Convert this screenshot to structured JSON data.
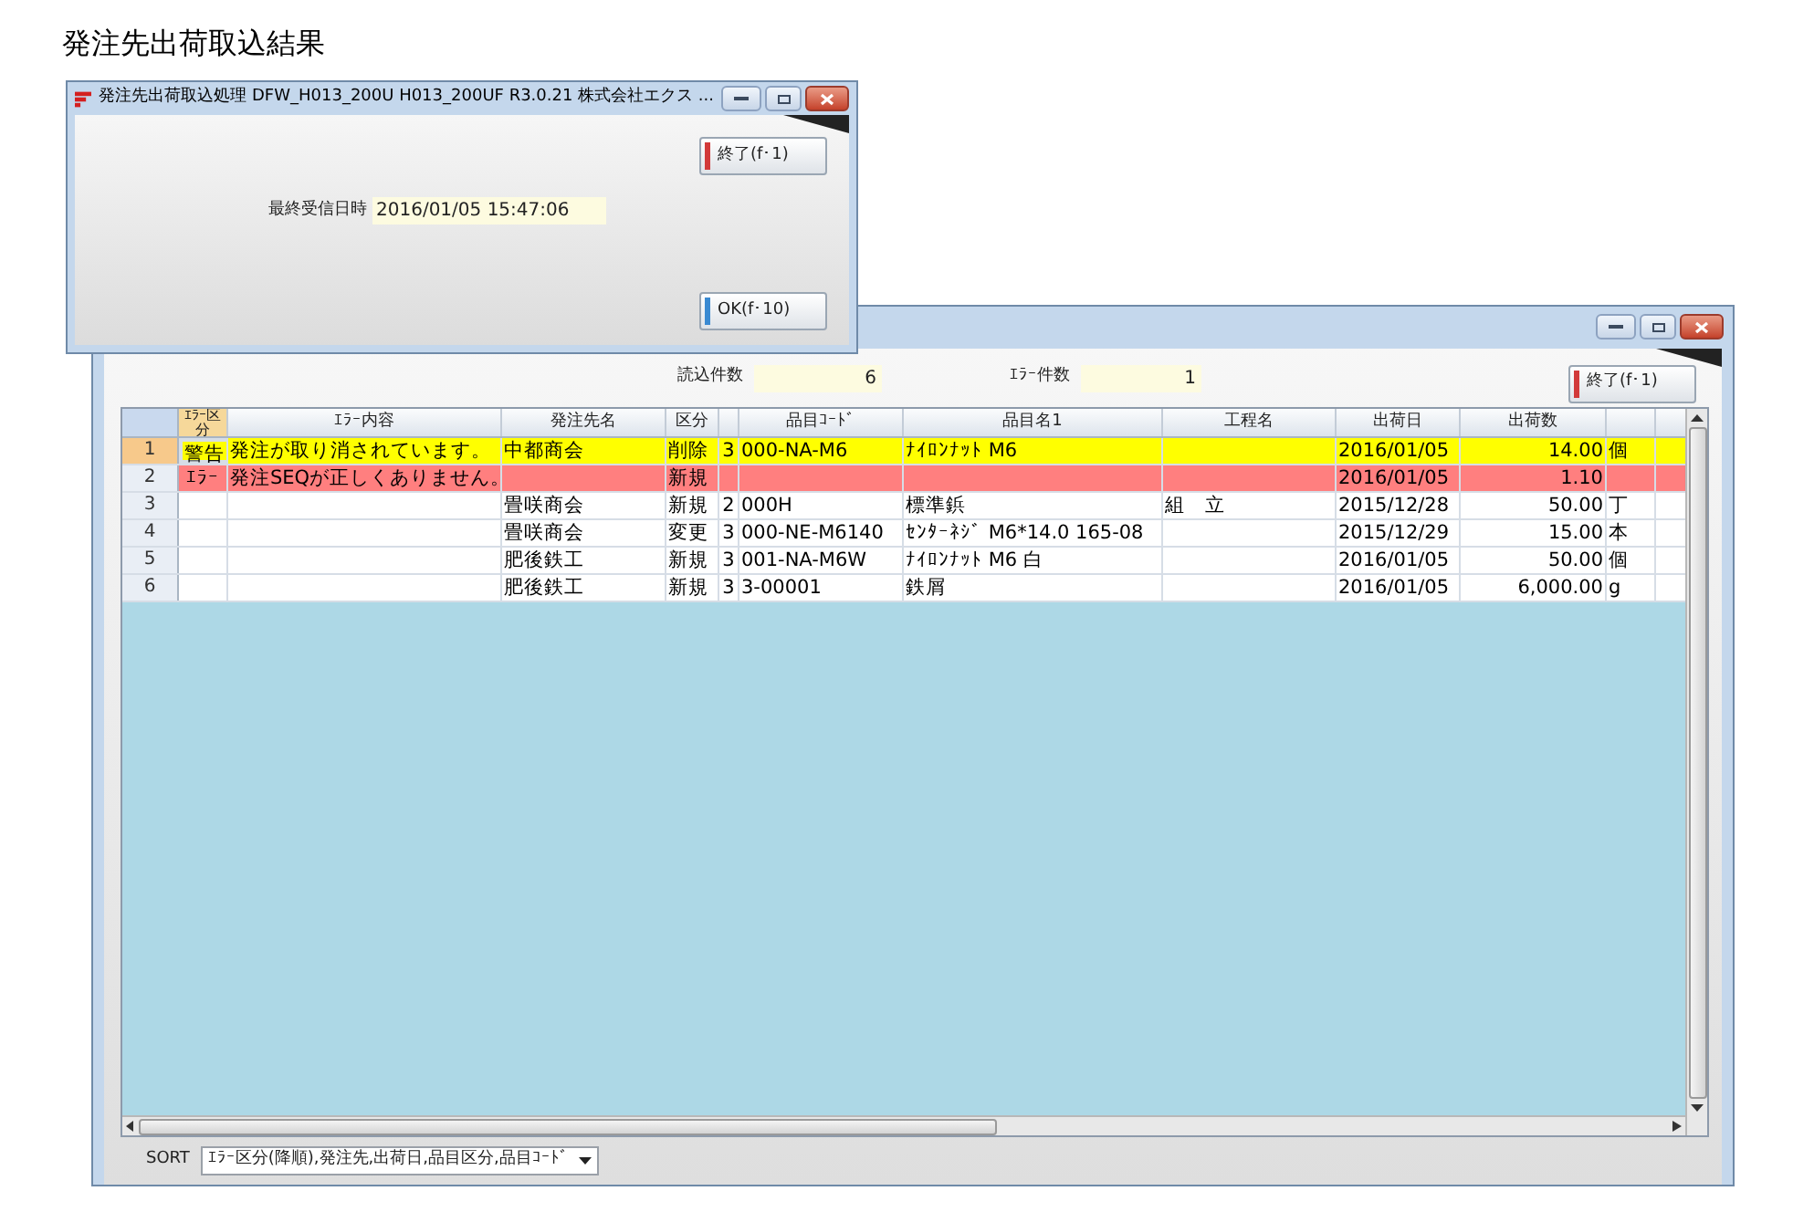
{
  "page_title": "発注先出荷取込結果",
  "dialog": {
    "title": "発注先出荷取込処理 DFW_H013_200U H013_200UF R3.0.21 株式会社エクス ...",
    "close_button": "終了(f･1)",
    "last_received_label": "最終受信日時",
    "last_received_value": "2016/01/05 15:47:06",
    "ok_button": "OK(f･10)"
  },
  "main_window": {
    "read_count_label": "読込件数",
    "read_count": "6",
    "error_count_label": "ｴﾗｰ件数",
    "error_count": "1",
    "close_button": "終了(f･1)",
    "table": {
      "columns": [
        {
          "kind": "text",
          "label": "ｴﾗｰ区分"
        },
        {
          "kind": "text",
          "label": "ｴﾗｰ内容"
        },
        {
          "kind": "text",
          "label": "発注先名"
        },
        {
          "kind": "text",
          "label": "区分"
        },
        {
          "kind": "blank"
        },
        {
          "kind": "text",
          "label": "品目ｺｰﾄﾞ"
        },
        {
          "kind": "text",
          "label": "品目名1"
        },
        {
          "kind": "text",
          "label": "工程名"
        },
        {
          "kind": "text",
          "label": "出荷日"
        },
        {
          "kind": "text",
          "label": "出荷数"
        },
        {
          "kind": "blank"
        }
      ],
      "rows": [
        {
          "kind": "warning",
          "selected": true,
          "number": "1",
          "error_type": "警告",
          "error_message": "発注が取り消されています。",
          "supplier": "中都商会",
          "category": "削除",
          "class_no": "3",
          "item_code": "000-NA-M6",
          "item_name": "ﾅｲﾛﾝﾅｯﾄ M6",
          "ship_date": "2016/01/05",
          "quantity": "14.00",
          "unit": "個"
        },
        {
          "kind": "error",
          "selected": false,
          "number": "2",
          "error_type": "ｴﾗｰ",
          "error_message": "発注SEQが正しくありません。",
          "category": "新規",
          "ship_date": "2016/01/05",
          "quantity": "1.10"
        },
        {
          "kind": "normal",
          "selected": false,
          "number": "3",
          "supplier": "畳咲商会",
          "category": "新規",
          "class_no": "2",
          "item_code": "000H",
          "item_name": "標準鋲",
          "process": "組　立",
          "ship_date": "2015/12/28",
          "quantity": "50.00",
          "unit": "丁"
        },
        {
          "kind": "normal",
          "selected": false,
          "number": "4",
          "supplier": "畳咲商会",
          "category": "変更",
          "class_no": "3",
          "item_code": "000-NE-M6140",
          "item_name": "ｾﾝﾀｰﾈｼﾞ M6*14.0 165-08",
          "ship_date": "2015/12/29",
          "quantity": "15.00",
          "unit": "本"
        },
        {
          "kind": "normal",
          "selected": false,
          "number": "5",
          "supplier": "肥後鉄工",
          "category": "新規",
          "class_no": "3",
          "item_code": "001-NA-M6W",
          "item_name": "ﾅｲﾛﾝﾅｯﾄ M6 白",
          "ship_date": "2016/01/05",
          "quantity": "50.00",
          "unit": "個"
        },
        {
          "kind": "normal",
          "selected": false,
          "number": "6",
          "supplier": "肥後鉄工",
          "category": "新規",
          "class_no": "3",
          "item_code": "3-00001",
          "item_name": "鉄屑",
          "ship_date": "2016/01/05",
          "quantity": "6,000.00",
          "unit": "g"
        }
      ]
    },
    "sort": {
      "label": "SORT",
      "value": "ｴﾗｰ区分(降順),発注先,出荷日,品目区分,品目ｺｰﾄﾞ"
    }
  }
}
